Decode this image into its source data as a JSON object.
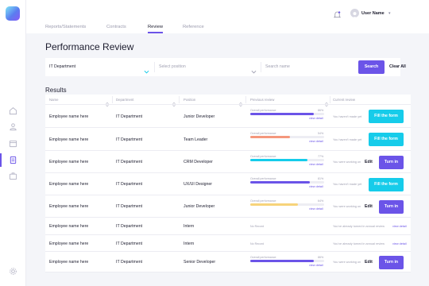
{
  "header": {
    "tabs": [
      {
        "label": "Reports/Statements"
      },
      {
        "label": "Contracts"
      },
      {
        "label": "Review"
      },
      {
        "label": "Reference"
      }
    ],
    "active_tab": "Review",
    "user_name": "User Name"
  },
  "sidebar": {
    "items": [
      {
        "icon": "home-icon"
      },
      {
        "icon": "users-icon"
      },
      {
        "icon": "calendar-icon"
      },
      {
        "icon": "document-icon",
        "active": true
      },
      {
        "icon": "briefcase-icon"
      },
      {
        "icon": "settings-icon"
      }
    ]
  },
  "page": {
    "title": "Performance Review"
  },
  "filters": {
    "department": "IT Department",
    "position_placeholder": "Select position",
    "search_placeholder": "Search name",
    "search_label": "Search",
    "clear_label": "Clear All"
  },
  "results": {
    "title": "Results",
    "columns": [
      "Name",
      "Department",
      "Position",
      "Previous review",
      "Current review"
    ],
    "rows": [
      {
        "name": "Employee name here",
        "department": "IT Department",
        "position": "Junior Developer",
        "prev": {
          "label": "Overall performance",
          "pct": "86%",
          "value": 0.86,
          "color": "#6b54e8",
          "link": "view detail"
        },
        "cur": {
          "text": "You haven't made yet",
          "action": "Fill the form"
        }
      },
      {
        "name": "Employee name here",
        "department": "IT Department",
        "position": "Team Leader",
        "prev": {
          "label": "Overall performance",
          "pct": "54%",
          "value": 0.54,
          "color": "#f4977c",
          "link": "view detail"
        },
        "cur": {
          "text": "You haven't made yet",
          "action": "Fill the form"
        }
      },
      {
        "name": "Employee name here",
        "department": "IT Department",
        "position": "CRM Developer",
        "prev": {
          "label": "Overall performance",
          "pct": "77%",
          "value": 0.77,
          "color": "#16ccea",
          "link": "view detail"
        },
        "cur": {
          "text": "You were working on",
          "edit": "Edit",
          "action": "Turn in"
        }
      },
      {
        "name": "Employee name here",
        "department": "IT Department",
        "position": "UX/UI Designer",
        "prev": {
          "label": "Overall performance",
          "pct": "81%",
          "value": 0.81,
          "color": "#6b54e8",
          "link": "view detail"
        },
        "cur": {
          "text": "You haven't made yet",
          "action": "Fill the form"
        }
      },
      {
        "name": "Employee name here",
        "department": "IT Department",
        "position": "Junior Developer",
        "prev": {
          "label": "Overall performance",
          "pct": "64%",
          "value": 0.64,
          "color": "#f7d37a",
          "link": "view detail"
        },
        "cur": {
          "text": "You were working on",
          "edit": "Edit",
          "action": "Turn in"
        }
      },
      {
        "name": "Employee name here",
        "department": "IT Department",
        "position": "Intern",
        "prev": {
          "label": "No Record"
        },
        "cur": {
          "text": "You've already turned in annual review",
          "link": "view detail"
        }
      },
      {
        "name": "Employee name here",
        "department": "IT Department",
        "position": "Intern",
        "prev": {
          "label": "No Record"
        },
        "cur": {
          "text": "You've already turned in annual review",
          "link": "view detail"
        }
      },
      {
        "name": "Employee name here",
        "department": "IT Department",
        "position": "Senior Developer",
        "prev": {
          "label": "Overall performance",
          "pct": "86%",
          "value": 0.86,
          "color": "#6b54e8",
          "link": "view detail"
        },
        "cur": {
          "text": "You were working on",
          "edit": "Edit",
          "action": "Turn in"
        }
      }
    ]
  }
}
